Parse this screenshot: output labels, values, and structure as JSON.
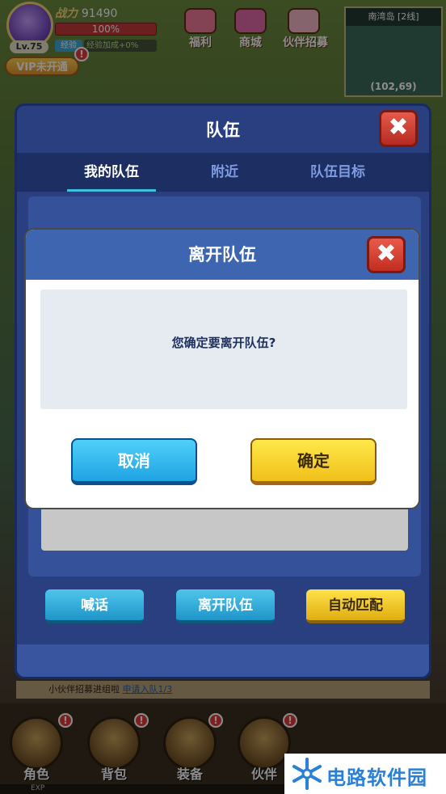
{
  "hud": {
    "level": "Lv.75",
    "power_label": "战力",
    "power_value": "91490",
    "hp_percent": "100%",
    "exp_label": "经验",
    "exp_bonus": "经验加成+0%",
    "vip": "VIP未开通",
    "top_menu": [
      {
        "label": "福利",
        "color": "#f07a9a"
      },
      {
        "label": "商城",
        "color": "#e06aa8"
      },
      {
        "label": "伙伴招募",
        "color": "#f2b6c9"
      }
    ],
    "minimap": {
      "title": "南湾岛 [2线]",
      "coords": "(102,69)"
    },
    "notice_text": "小伙伴招募进组啦",
    "notice_link": "申请入队1/3",
    "bottom_nav": [
      {
        "label": "角色"
      },
      {
        "label": "背包"
      },
      {
        "label": "装备"
      },
      {
        "label": "伙伴"
      }
    ],
    "exp_strip": "EXP"
  },
  "team_panel": {
    "title": "队伍",
    "tabs": [
      {
        "label": "我的队伍",
        "active": true
      },
      {
        "label": "附近",
        "active": false
      },
      {
        "label": "队伍目标",
        "active": false
      }
    ],
    "buttons": {
      "shout": "喊话",
      "leave": "离开队伍",
      "auto_match": "自动匹配"
    }
  },
  "dialog": {
    "title": "离开队伍",
    "message": "您确定要离开队伍?",
    "cancel": "取消",
    "confirm": "确定"
  },
  "watermark": {
    "text": "电路软件园"
  }
}
